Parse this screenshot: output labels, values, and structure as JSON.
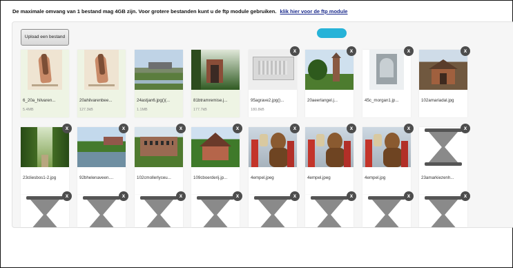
{
  "notice": {
    "text": "De maximale omvang van 1 bestand mag 4GB zijn. Voor grotere bestanden kunt u de ftp module gebruiken.",
    "link": "klik hier voor de ftp module"
  },
  "upload": {
    "label": "Upload een bestand",
    "progress": "uploading"
  },
  "colors": {
    "progress": "#27b3d8",
    "close": "#4d4d4d",
    "link": "#1a2a8c"
  },
  "close_label": "x",
  "files": [
    {
      "name": "6_20a_hilvaren...",
      "size": "5.4MB",
      "done": true,
      "thumb": "sketch"
    },
    {
      "name": "20ahilvarenbee...",
      "size": "127.3kB",
      "done": true,
      "thumb": "sketch"
    },
    {
      "name": "24astjan6.jpg()(...",
      "size": "1.1MB",
      "done": true,
      "thumb": "landscape"
    },
    {
      "name": "81btramremise.j...",
      "size": "177.7kB",
      "done": true,
      "thumb": "trees-building"
    },
    {
      "name": "95agrave2.jpg()...",
      "size": "180.8kB",
      "done": false,
      "thumb": "drawing"
    },
    {
      "name": "20aeerlangel.j...",
      "size": "",
      "done": false,
      "thumb": "church"
    },
    {
      "name": "45c_morgan1.jp...",
      "size": "",
      "done": false,
      "thumb": "monument"
    },
    {
      "name": "102amariadal.jpg",
      "size": "",
      "done": false,
      "thumb": "farmhouse"
    },
    {
      "name": "23cliesbos1-2.jpg",
      "size": "",
      "done": false,
      "thumb": "forest"
    },
    {
      "name": "92bhelenaveen....",
      "size": "",
      "done": false,
      "thumb": "canal"
    },
    {
      "name": "102cmollerlyceu...",
      "size": "",
      "done": false,
      "thumb": "school"
    },
    {
      "name": "109cboerderij.jp...",
      "size": "",
      "done": false,
      "thumb": "house"
    },
    {
      "name": "4empel.jpeg",
      "size": "",
      "done": false,
      "thumb": "parade"
    },
    {
      "name": "4empel.jpeg",
      "size": "",
      "done": false,
      "thumb": "parade"
    },
    {
      "name": "4empel.jpg",
      "size": "",
      "done": false,
      "thumb": "parade"
    },
    {
      "name": "23amarkiezenh...",
      "size": "",
      "done": false,
      "thumb": "hourglass"
    },
    {
      "name": "",
      "size": "",
      "done": false,
      "thumb": "hourglass"
    },
    {
      "name": "",
      "size": "",
      "done": false,
      "thumb": "hourglass"
    },
    {
      "name": "",
      "size": "",
      "done": false,
      "thumb": "hourglass"
    },
    {
      "name": "",
      "size": "",
      "done": false,
      "thumb": "hourglass"
    },
    {
      "name": "",
      "size": "",
      "done": false,
      "thumb": "hourglass"
    },
    {
      "name": "",
      "size": "",
      "done": false,
      "thumb": "hourglass"
    },
    {
      "name": "",
      "size": "",
      "done": false,
      "thumb": "hourglass"
    },
    {
      "name": "",
      "size": "",
      "done": false,
      "thumb": "hourglass"
    }
  ]
}
